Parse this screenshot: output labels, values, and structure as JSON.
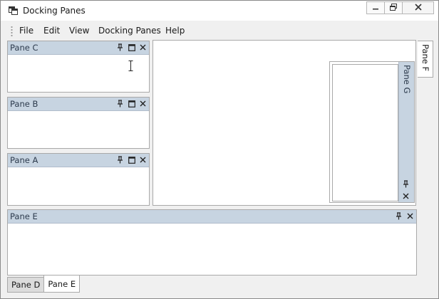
{
  "window": {
    "title": "Docking Panes",
    "icons": {
      "app": "docking-app-icon",
      "minimize": "minimize-icon",
      "restore": "restore-icon",
      "close": "close-icon"
    }
  },
  "menu": {
    "items": [
      {
        "label": "File"
      },
      {
        "label": "Edit"
      },
      {
        "label": "View"
      },
      {
        "label": "Docking Panes"
      },
      {
        "label": "Help"
      }
    ]
  },
  "panes": {
    "c": {
      "title": "Pane C"
    },
    "b": {
      "title": "Pane B"
    },
    "a": {
      "title": "Pane A"
    },
    "e": {
      "title": "Pane E"
    },
    "g": {
      "title": "Pane G"
    },
    "f": {
      "title": "Pane F"
    }
  },
  "bottom_tabs": [
    {
      "label": "Pane D",
      "active": false
    },
    {
      "label": "Pane E",
      "active": true
    }
  ],
  "colors": {
    "pane_header": "#c7d4e1",
    "pane_title_text": "#2d3b4d",
    "border": "#a9a9a9",
    "window_bg": "#f0f0f0"
  }
}
